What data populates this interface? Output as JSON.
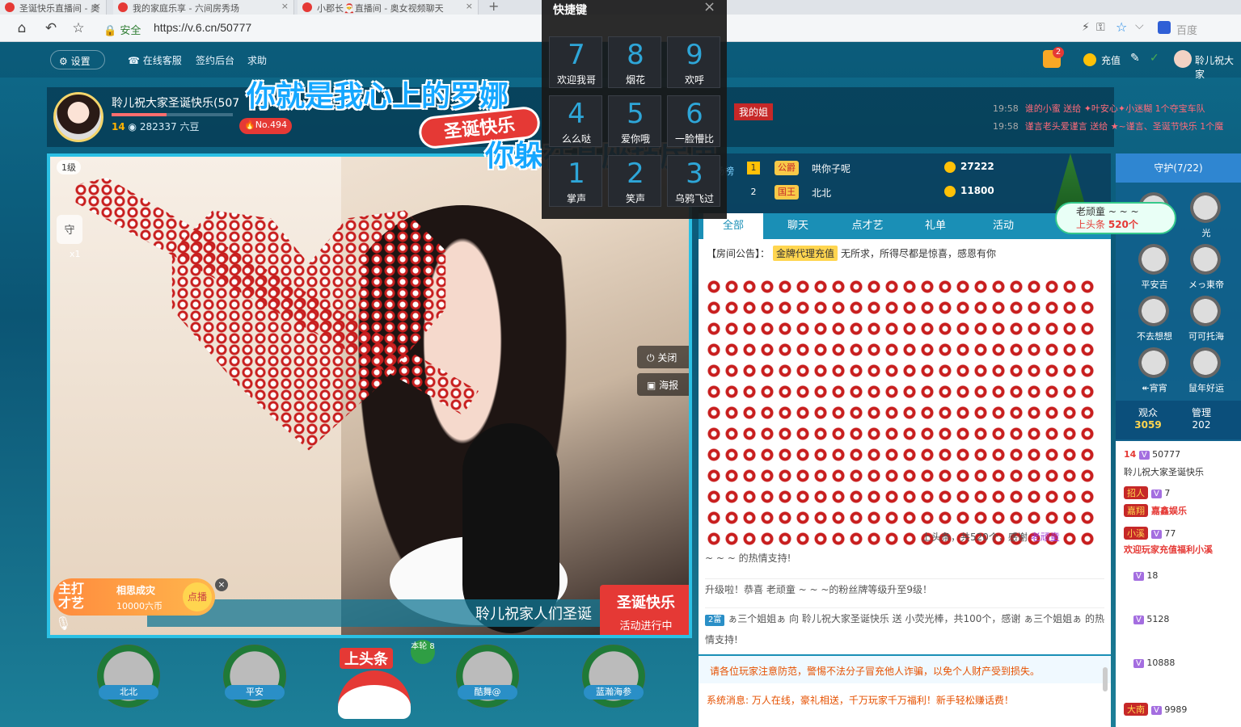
{
  "browser": {
    "tabs": [
      {
        "title": "圣诞快乐直播间 - 奥"
      },
      {
        "title": "我的家庭乐享 - 六间房秀场"
      },
      {
        "title": "小郡长🎅直播间 - 奥女视频聊天"
      }
    ],
    "secure_label": "安全",
    "url": "https://v.6.cn/50777",
    "search_engine": "百度"
  },
  "topnav": {
    "settings": "设置",
    "service": "在线客服",
    "signin": "签约后台",
    "help": "求助",
    "recharge": "充值",
    "notif_count": "2",
    "user": "聆儿祝大家"
  },
  "anchor": {
    "name": "聆儿祝大家圣诞快乐(507",
    "level": "14",
    "beans": "282337 六豆",
    "rank": "No.494",
    "progress_fraction": 0.45
  },
  "overlay": {
    "line1": "你就是我心上的罗娜",
    "line2": "你躲在某座毡房里",
    "sticker": "圣诞快乐",
    "house": "我的姐"
  },
  "ticker": [
    {
      "time": "19:58",
      "text": "谁的小蜜 送给 ✦叶安心✦小迷糊 1个夺宝车队"
    },
    {
      "time": "19:58",
      "text": "谨言老头爱谨言 送给 ★~谨言、圣诞节快乐 1个魔"
    }
  ],
  "video": {
    "level_chip": "1级",
    "guard_label": "守",
    "guard_count": "x1",
    "close_btn": "关闭",
    "poster_btn": "海报",
    "marquee": "聆儿祝家人们圣诞",
    "activity_title": "圣诞快乐",
    "activity_status": "活动进行中",
    "talent_tag": "主打才艺",
    "talent_song": "相思成灾",
    "talent_price": "10000六币",
    "talent_play": "点播"
  },
  "seats": [
    {
      "name": "北北"
    },
    {
      "name": "平安"
    },
    {
      "name": "酷舞@"
    },
    {
      "name": "蓝瀚海参"
    }
  ],
  "headline_seat": {
    "label": "上头条",
    "round": "本轮 8"
  },
  "rank": {
    "title": "本场榜单",
    "rows": [
      {
        "idx": "1",
        "badge": "公爵",
        "name": "哄你子呢",
        "value": "27222"
      },
      {
        "idx": "2",
        "badge": "国王",
        "name": "北北",
        "value": "11800"
      }
    ]
  },
  "chat_tabs": [
    "全部",
    "聊天",
    "点才艺",
    "礼单",
    "活动"
  ],
  "chat": {
    "announce_label": "【房间公告】：",
    "announce_badge": "金牌代理充值",
    "announce_text": "无所求，所得尽都是惊喜，感恩有你",
    "gift_text": "上头条，共520个，感谢",
    "gift_who": "老顽童",
    "gift_tail": "~ ~ ~ 的热情支持!",
    "upgrade": "升级啦！恭喜 老顽童 ~ ~ ~的粉丝牌等级升至9级！",
    "gift2_lvl": "2富",
    "gift2": "ぁ三个姐姐ぁ 向 聆儿祝大家圣诞快乐 送 小荧光棒，共100个，感谢 ぁ三个姐姐ぁ 的热情支持!",
    "notice": "请各位玩家注意防范，警惕不法分子冒充他人诈骗，以免个人财产受到损失。",
    "system": "系统消息: 万人在线，豪礼相送，千万玩家千万福利！新手轻松赚话费！"
  },
  "sidebar": {
    "guard_tab": "守护(7/22)",
    "guards": [
      "",
      "光",
      "平安吉",
      "メっ東帝",
      "不去想想",
      "可可托海",
      "↞宵宵",
      "鼠年好运"
    ],
    "viewers_label": "观众",
    "viewers_count": "3059",
    "admins_label": "管理",
    "admins_count": "202",
    "audience": [
      {
        "level": "14",
        "text": "50777"
      },
      {
        "text": "聆儿祝大家圣诞快乐"
      },
      {
        "badge": "招人",
        "text": "7"
      },
      {
        "badge": "嘉翔",
        "text": "嘉鑫娱乐"
      },
      {
        "badge": "小溪",
        "text": "77"
      },
      {
        "text": "欢迎玩家充值福利小溪"
      },
      {
        "badge": "",
        "text": "18"
      },
      {
        "badge": "",
        "text": "5128"
      },
      {
        "badge": "",
        "text": "10888"
      },
      {
        "badge": "大南",
        "text": "9989"
      }
    ]
  },
  "headline_tip": {
    "who": "老顽童 ~ ~ ~",
    "label": "上头条",
    "count": "520个"
  },
  "shortcut": {
    "title": "快捷键",
    "keys": [
      {
        "d": "7",
        "l": "欢迎我哥"
      },
      {
        "d": "8",
        "l": "烟花"
      },
      {
        "d": "9",
        "l": "欢呼"
      },
      {
        "d": "4",
        "l": "么么哒"
      },
      {
        "d": "5",
        "l": "爱你哦"
      },
      {
        "d": "6",
        "l": "一脸懵比"
      },
      {
        "d": "1",
        "l": "掌声"
      },
      {
        "d": "2",
        "l": "笑声"
      },
      {
        "d": "3",
        "l": "乌鸦飞过"
      }
    ]
  },
  "colors": {
    "accent": "#2bc0e4",
    "brand_red": "#e53935",
    "gold": "#ffd54f"
  }
}
